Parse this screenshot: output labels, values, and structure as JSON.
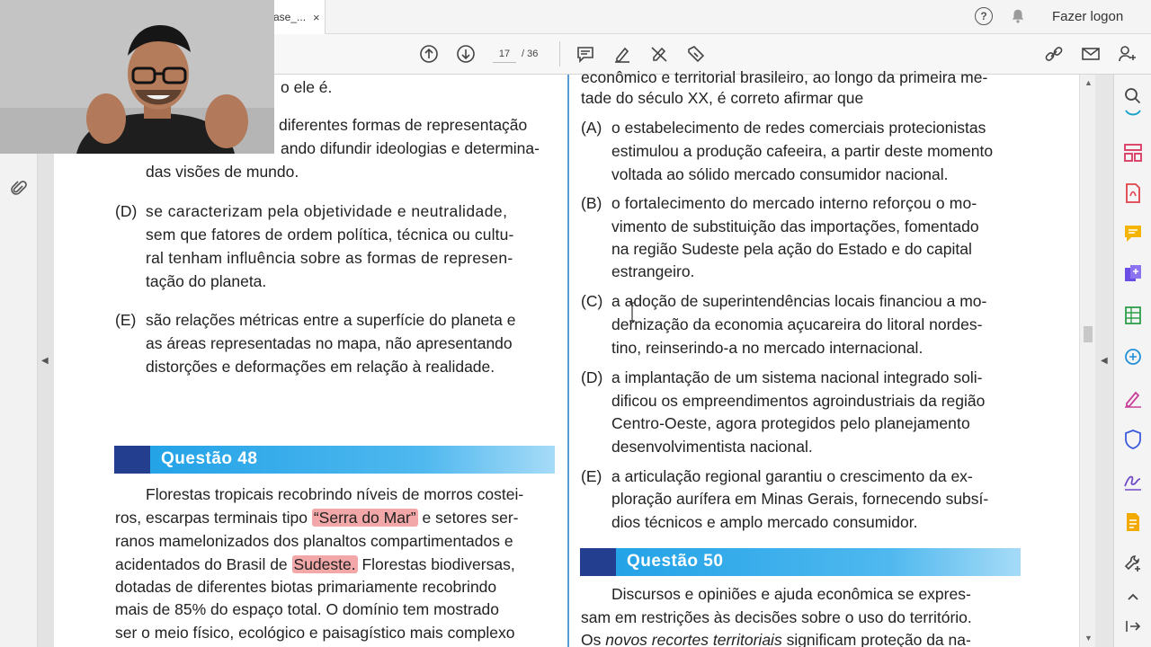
{
  "tab": {
    "label": "ase_...",
    "close": "×"
  },
  "header": {
    "help": "?",
    "login_label": "Fazer logon"
  },
  "toolbar": {
    "page_current": "17",
    "page_total": "/ 36"
  },
  "left_column": {
    "line_top": "o ele é.",
    "c_lines": [
      "diferentes formas de representação",
      "ando difundir ideologias e determina-",
      "das visões de mundo."
    ],
    "d_label": "(D)",
    "d_lines": [
      "se caracterizam pela objetividade e neutralidade,",
      "sem que fatores de ordem política, técnica ou cultu-",
      "ral tenham influência sobre as formas de represen-",
      "tação do planeta."
    ],
    "e_label": "(E)",
    "e_lines": [
      "são relações métricas entre a superfície do planeta e",
      "as áreas representadas no mapa, não apresentando",
      "distorções e deformações em relação à realidade."
    ],
    "q48_title": "Questão 48",
    "q48_lines": {
      "l1": "Florestas tropicais recobrindo níveis de morros costei-",
      "l2a": "ros, escarpas terminais tipo ",
      "l2hl": "“Serra do Mar”",
      "l2b": " e setores ser-",
      "l3": "ranos mamelonizados dos planaltos compartimentados e",
      "l4a": "acidentados do Brasil de ",
      "l4hl": "Sudeste.",
      "l4b": " Florestas biodiversas,",
      "l5": "dotadas de diferentes biotas primariamente recobrindo",
      "l6": "mais de 85% do espaço total. O domínio tem mostrado",
      "l7": "ser o meio físico, ecológico e paisagístico mais complexo"
    }
  },
  "right_column": {
    "intro": [
      "econômico e territorial brasileiro, ao longo da primeira me-",
      "tade do século XX, é correto afirmar que"
    ],
    "options": [
      {
        "label": "(A)",
        "lines": [
          "o estabelecimento de redes comerciais protecionistas",
          "estimulou a produção cafeeira, a partir deste momento",
          "voltada ao sólido mercado consumidor nacional."
        ]
      },
      {
        "label": "(B)",
        "lines": [
          "o fortalecimento do mercado interno reforçou o mo-",
          "vimento de substituição das importações, fomentado",
          "na região Sudeste pela ação do Estado e do capital",
          "estrangeiro."
        ]
      },
      {
        "label": "(C)",
        "lines": [
          "a adoção de superintendências locais financiou a mo-",
          "dernização da economia açucareira do litoral nordes-",
          "tino, reinserindo-a no mercado internacional."
        ]
      },
      {
        "label": "(D)",
        "lines": [
          "a implantação de um sistema nacional integrado soli-",
          "dificou os empreendimentos agroindustriais da região",
          "Centro-Oeste, agora protegidos pelo planejamento",
          "desenvolvimentista nacional."
        ]
      },
      {
        "label": "(E)",
        "lines": [
          "a articulação regional garantiu o crescimento da ex-",
          "ploração aurífera em Minas Gerais, fornecendo subsí-",
          "dios técnicos e amplo mercado consumidor."
        ]
      }
    ],
    "q50_title": "Questão 50",
    "q50_lines": {
      "l1": "Discursos e opiniões e ajuda econômica se expres-",
      "l2": "sam em restrições às decisões sobre o uso do território.",
      "l3a": "Os ",
      "l3i": "novos recortes territoriais",
      "l3b": " significam proteção da na-"
    }
  },
  "colors": {
    "banner_start": "#1ea0e6",
    "banner_block": "#233e8f",
    "highlight": "#f2a8a8",
    "column_rule": "#5a9ad6"
  }
}
